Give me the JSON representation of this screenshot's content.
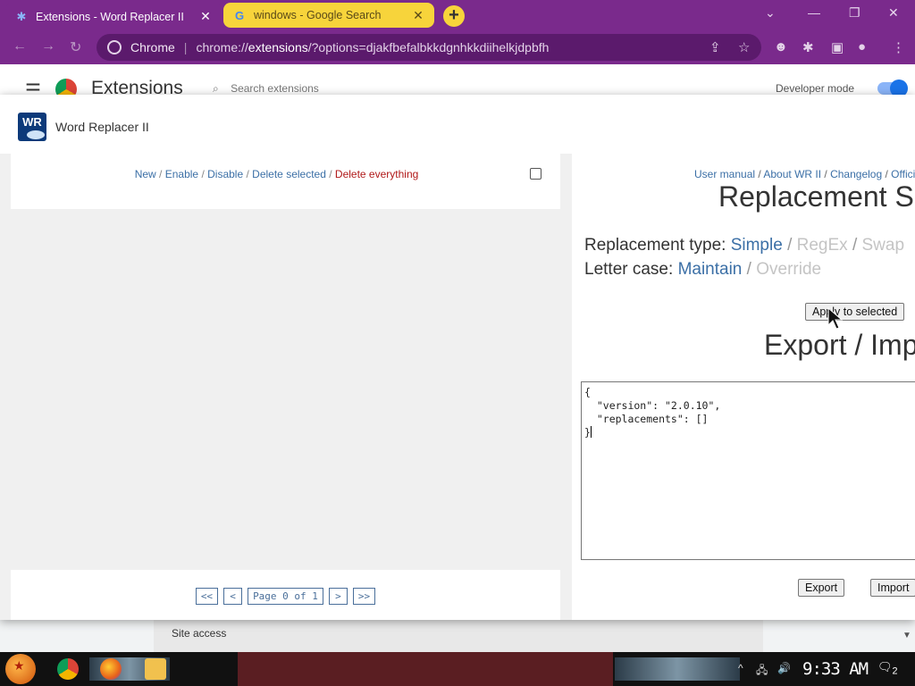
{
  "browser": {
    "tabs": [
      {
        "title": "Extensions - Word Replacer II",
        "active": true,
        "favicon": "puzzle-icon"
      },
      {
        "title": "windows - Google Search",
        "active": false,
        "favicon": "google-icon"
      }
    ],
    "omnibox": {
      "site_label": "Chrome",
      "url_prefix": "chrome://",
      "url_host": "extensions",
      "url_rest": "/?options=djakfbefalbkkdgnhkkdiihelkjdpbfh"
    }
  },
  "extensions_page": {
    "title": "Extensions",
    "search_placeholder": "Search extensions",
    "developer_mode_label": "Developer mode",
    "developer_mode_on": true,
    "site_access_label": "Site access"
  },
  "dialog": {
    "title": "Word Replacer II",
    "logo_text": "WR",
    "left": {
      "actions": [
        {
          "label": "New",
          "danger": false
        },
        {
          "label": "Enable",
          "danger": false
        },
        {
          "label": "Disable",
          "danger": false
        },
        {
          "label": "Delete selected",
          "danger": false
        },
        {
          "label": "Delete everything",
          "danger": true
        }
      ],
      "pager": {
        "first": "<<",
        "prev": "<",
        "page_text": "Page 0 of 1",
        "next": ">",
        "last": ">>"
      }
    },
    "right": {
      "links": [
        "User manual",
        "About WR II",
        "Changelog",
        "Offici"
      ],
      "replacement_heading": "Replacement Se",
      "replacement_type_label": "Replacement type:",
      "replacement_type_options": [
        {
          "label": "Simple",
          "selected": true
        },
        {
          "label": "RegEx",
          "selected": false
        },
        {
          "label": "Swap",
          "selected": false
        }
      ],
      "letter_case_label": "Letter case:",
      "letter_case_options": [
        {
          "label": "Maintain",
          "selected": true
        },
        {
          "label": "Override",
          "selected": false
        }
      ],
      "apply_button": "Apply to selected",
      "export_heading": "Export / Imp",
      "json_text": "{\n  \"version\": \"2.0.10\",\n  \"replacements\": []\n}",
      "export_button": "Export",
      "import_button": "Import"
    }
  },
  "taskbar": {
    "time": "9:33 AM",
    "notification_count": "2"
  }
}
